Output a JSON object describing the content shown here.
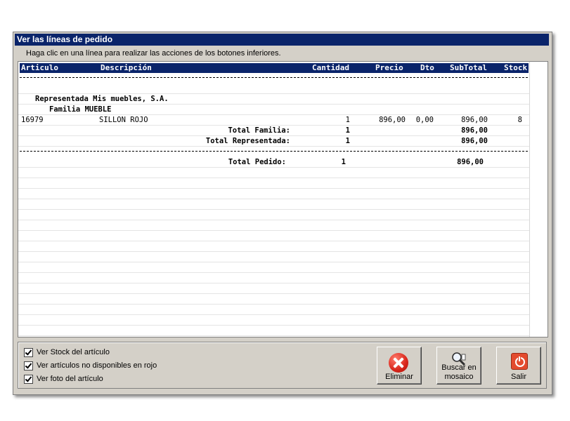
{
  "window": {
    "title": "Ver las líneas de pedido"
  },
  "instruction": "Haga clic en una línea para realizar las acciones de los botones inferiores.",
  "columns": {
    "articulo": "Articulo",
    "descripcion": "Descripción",
    "cantidad": "Cantidad",
    "precio": "Precio",
    "dto": "Dto",
    "subtotal": "SubTotal",
    "stock": "Stock"
  },
  "rows": {
    "representada": "Representada Mis muebles, S.A.",
    "familia": "Familia MUEBLE",
    "item": {
      "articulo": "16979",
      "descripcion": "SILLON ROJO",
      "cantidad": "1",
      "precio": "896,00",
      "dto": "0,00",
      "subtotal": "896,00",
      "stock": "8"
    },
    "total_familia": {
      "label": "Total Familia:",
      "cantidad": "1",
      "subtotal": "896,00"
    },
    "total_representada": {
      "label": "Total Representada:",
      "cantidad": "1",
      "subtotal": "896,00"
    },
    "total_pedido": {
      "label": "Total Pedido:",
      "cantidad": "1",
      "subtotal": "896,00"
    }
  },
  "options": {
    "ver_stock": "Ver Stock del artículo",
    "ver_no_disponibles": "Ver artículos no disponibles en rojo",
    "ver_foto": "Ver foto del artículo"
  },
  "buttons": {
    "eliminar": "Eliminar",
    "buscar_line1": "Buscar en",
    "buscar_line2": "mosaico",
    "salir": "Salir"
  },
  "icons": {
    "eliminar": "delete-x-icon",
    "buscar": "magnifier-icon",
    "salir": "power-icon"
  },
  "colors": {
    "titlebar": "#0a246a",
    "delete": "#d8251a",
    "exit": "#e34b2e"
  }
}
